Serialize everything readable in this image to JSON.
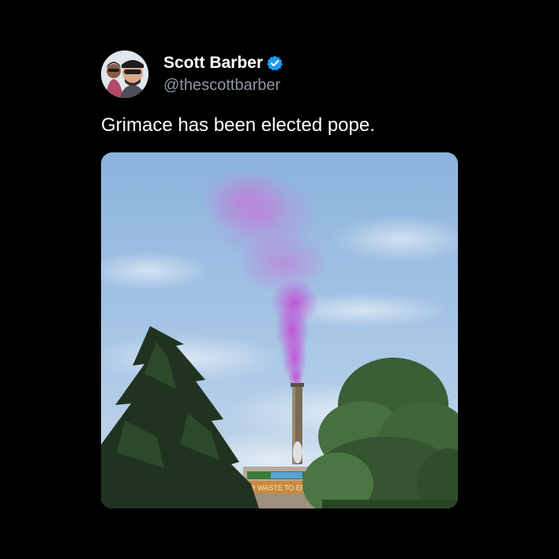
{
  "tweet": {
    "display_name": "Scott Barber",
    "handle": "@thescottbarber",
    "text": "Grimace has been elected pope.",
    "verified": true
  },
  "media": {
    "sign_text": "ER WASTE TO ENERGY"
  },
  "colors": {
    "background": "#000000",
    "name": "#ffffff",
    "handle": "#8b98a5",
    "verified_badge": "#1d9bf0",
    "smoke": "#c24fd6"
  },
  "icons": {
    "verified": "verified-badge-icon"
  }
}
